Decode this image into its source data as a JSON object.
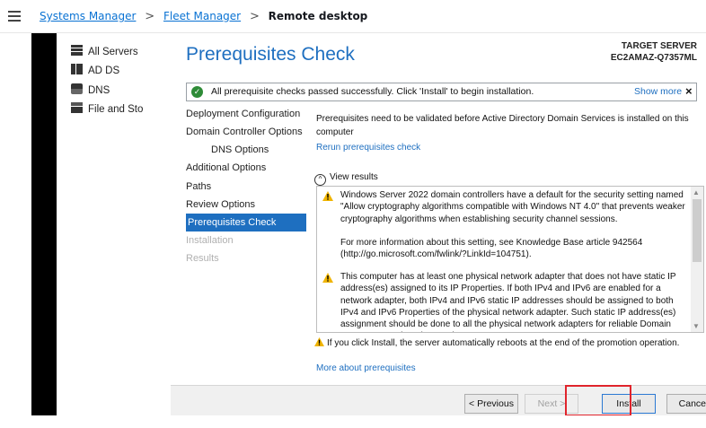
{
  "breadcrumb": {
    "items": [
      "Systems Manager",
      "Fleet Manager"
    ],
    "current": "Remote desktop",
    "separator": ">"
  },
  "left_panel": {
    "items": [
      {
        "icon": "servers-icon",
        "label": "All Servers"
      },
      {
        "icon": "ad-ds-icon",
        "label": "AD DS"
      },
      {
        "icon": "dns-icon",
        "label": "DNS"
      },
      {
        "icon": "file-storage-icon",
        "label": "File and Sto"
      }
    ]
  },
  "dialog": {
    "title": "Prerequisites Check",
    "target_label": "TARGET SERVER",
    "target_server": "EC2AMAZ-Q7357ML",
    "banner": {
      "message": "All prerequisite checks passed successfully.  Click 'Install' to begin installation.",
      "show_more": "Show more",
      "close": "×"
    },
    "nav": [
      {
        "label": "Deployment Configuration",
        "state": "normal"
      },
      {
        "label": "Domain Controller Options",
        "state": "normal"
      },
      {
        "label": "DNS Options",
        "state": "indent"
      },
      {
        "label": "Additional Options",
        "state": "normal"
      },
      {
        "label": "Paths",
        "state": "normal"
      },
      {
        "label": "Review Options",
        "state": "normal"
      },
      {
        "label": "Prerequisites Check",
        "state": "active"
      },
      {
        "label": "Installation",
        "state": "disabled"
      },
      {
        "label": "Results",
        "state": "disabled"
      }
    ],
    "description": "Prerequisites need to be validated before Active Directory Domain Services is installed on this computer",
    "rerun_link": "Rerun prerequisites check",
    "view_results": "View results",
    "results": [
      "Windows Server 2022 domain controllers have a default for the security setting named \"Allow cryptography algorithms compatible with Windows NT 4.0\" that prevents weaker cryptography algorithms when establishing security channel sessions.",
      "For more information about this setting, see Knowledge Base article 942564 (http://go.microsoft.com/fwlink/?LinkId=104751).",
      "This computer has at least one physical network adapter that does not have static IP address(es) assigned to its IP Properties. If both IPv4 and IPv6 are enabled for a network adapter, both IPv4 and IPv6 static IP addresses should be assigned to both IPv4 and IPv6 Properties of the physical network adapter. Such static IP address(es) assignment should be done to all the physical network adapters for reliable Domain Name System (DNS) operation."
    ],
    "install_note": "If you click Install, the server automatically reboots at the end of the promotion operation.",
    "more_link": "More about prerequisites",
    "buttons": {
      "previous": "< Previous",
      "next": "Next >",
      "install": "Install",
      "cancel": "Cancel"
    }
  },
  "colors": {
    "link": "#0972d3",
    "accent": "#1e6fc0",
    "highlight": "#e0242c",
    "success": "#2e8b37"
  }
}
